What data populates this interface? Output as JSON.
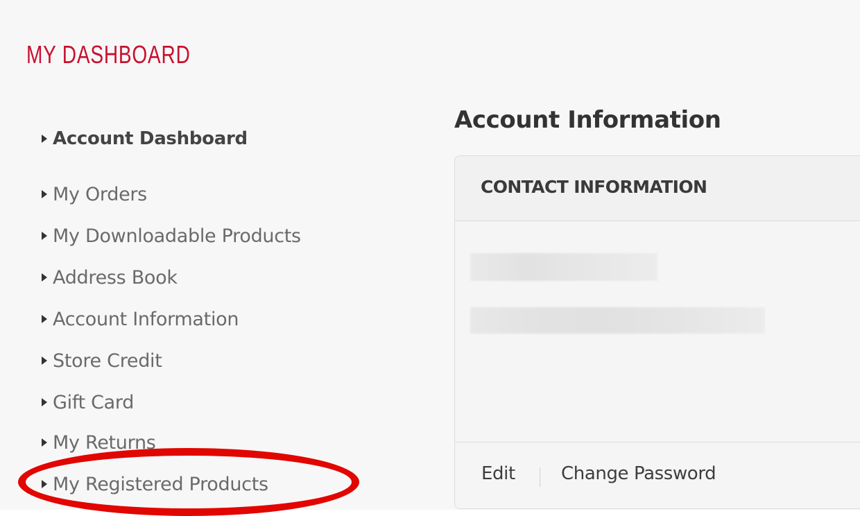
{
  "dashboard": {
    "title": "MY DASHBOARD",
    "title_color": "#c8102e"
  },
  "nav": {
    "items": [
      {
        "label": "Account Dashboard",
        "active": true
      },
      {
        "label": "My Orders",
        "active": false
      },
      {
        "label": "My Downloadable Products",
        "active": false
      },
      {
        "label": "Address Book",
        "active": false
      },
      {
        "label": "Account Information",
        "active": false
      },
      {
        "label": "Store Credit",
        "active": false
      },
      {
        "label": "Gift Card",
        "active": false
      },
      {
        "label": "My Returns",
        "active": false
      },
      {
        "label": "My Registered Products",
        "active": false
      }
    ],
    "arrow_icon": "caret-right-icon"
  },
  "main": {
    "section_title": "Account Information",
    "card": {
      "header_title": "CONTACT INFORMATION",
      "footer": {
        "edit_label": "Edit",
        "change_password_label": "Change Password"
      }
    }
  },
  "annotation": {
    "color": "#e10600",
    "target": "My Registered Products"
  }
}
